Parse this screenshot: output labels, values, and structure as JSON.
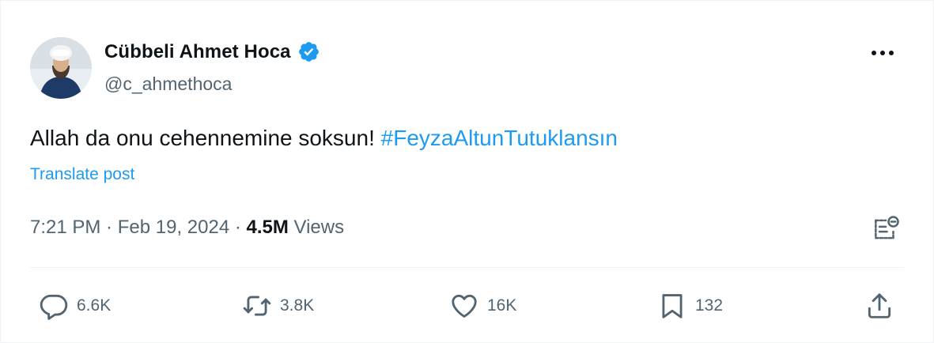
{
  "author": {
    "display_name": "Cübbeli Ahmet Hoca",
    "handle": "@c_ahmethoca",
    "verified": true,
    "avatar": "avatar-photo"
  },
  "post": {
    "text": "Allah da onu cehennemine soksun! ",
    "hashtag": "#FeyzaAltunTutuklansın",
    "translate_label": "Translate post"
  },
  "meta": {
    "time": "7:21 PM",
    "separator1": " · ",
    "date": "Feb 19, 2024",
    "separator2": " · ",
    "views_count": "4.5M",
    "views_label": " Views"
  },
  "actions": {
    "replies": "6.6K",
    "reposts": "3.8K",
    "likes": "16K",
    "bookmarks": "132"
  },
  "colors": {
    "accent": "#1d9bf0",
    "text": "#0f1419",
    "secondary": "#536471",
    "divider": "#eff3f4"
  },
  "icons": {
    "more": "more-dots-icon",
    "verified": "verified-badge-icon",
    "analytics": "analytics-icon",
    "reply": "reply-icon",
    "repost": "repost-icon",
    "like": "heart-icon",
    "bookmark": "bookmark-icon",
    "share": "share-icon"
  }
}
